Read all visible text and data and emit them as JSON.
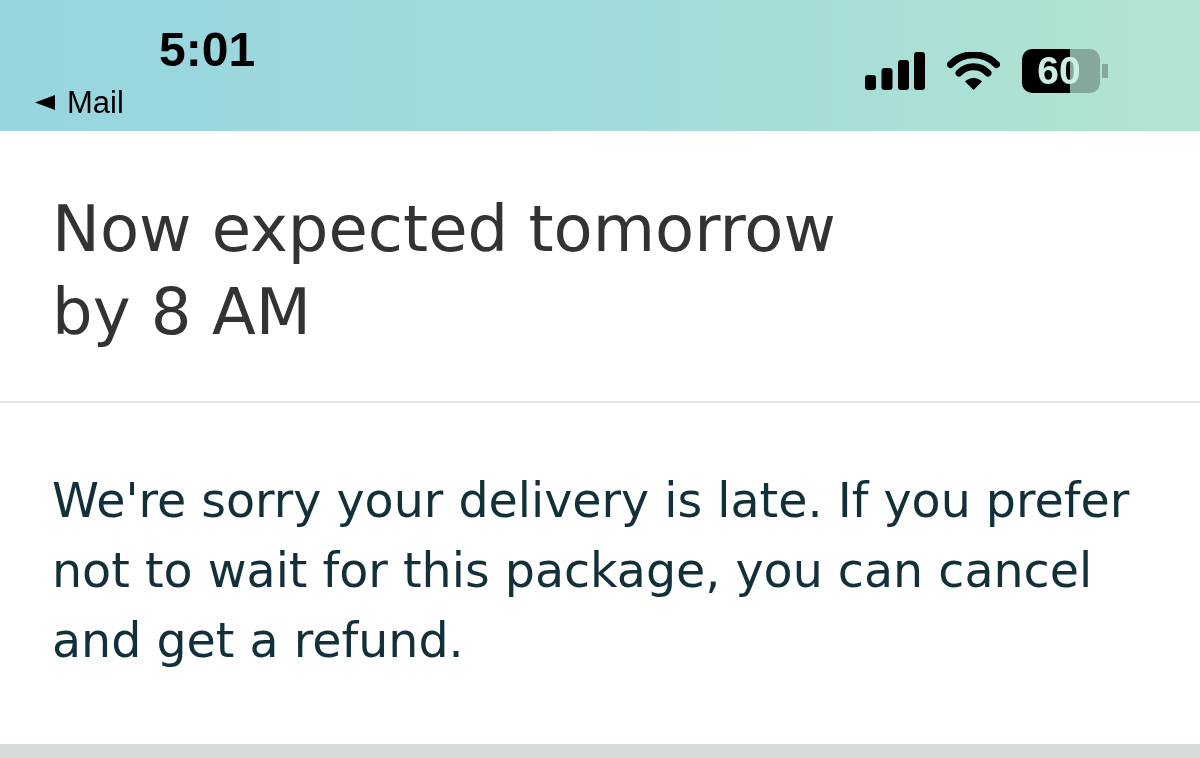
{
  "status_bar": {
    "time": "5:01",
    "back_link": "Mail",
    "battery_percent": "60"
  },
  "heading": "Now expected tomorrow by 8 AM",
  "message": "We're sorry your delivery is late. If you prefer not to wait for this package, you can cancel and get a refund."
}
